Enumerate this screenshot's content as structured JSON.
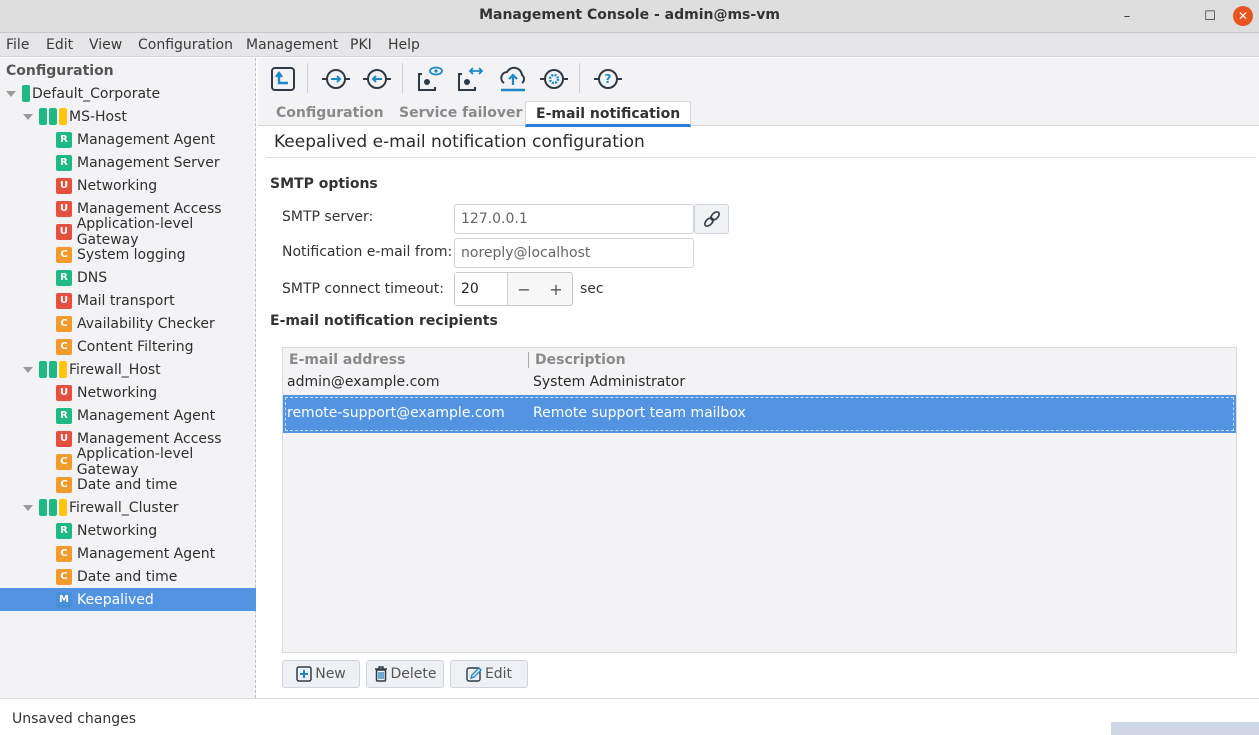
{
  "window": {
    "title": "Management Console - admin@ms-vm",
    "controls": {
      "minimize": "–",
      "maximize": "☐",
      "close": "✕"
    }
  },
  "menubar": [
    "File",
    "Edit",
    "View",
    "Configuration",
    "Management",
    "PKI",
    "Help"
  ],
  "sidebar": {
    "heading": "Configuration",
    "tree": [
      {
        "type": "root",
        "label": "Default_Corporate",
        "bars": [
          "green"
        ]
      },
      {
        "type": "host",
        "label": "MS-Host",
        "bars": [
          "green",
          "green",
          "yellow"
        ]
      },
      {
        "type": "item",
        "badge": "R",
        "label": "Management Agent"
      },
      {
        "type": "item",
        "badge": "R",
        "label": "Management Server"
      },
      {
        "type": "item",
        "badge": "U",
        "label": "Networking"
      },
      {
        "type": "item",
        "badge": "U",
        "label": "Management Access"
      },
      {
        "type": "item",
        "badge": "U",
        "label": "Application-level Gateway"
      },
      {
        "type": "item",
        "badge": "C",
        "label": "System logging"
      },
      {
        "type": "item",
        "badge": "R",
        "label": "DNS"
      },
      {
        "type": "item",
        "badge": "U",
        "label": "Mail transport"
      },
      {
        "type": "item",
        "badge": "C",
        "label": "Availability Checker"
      },
      {
        "type": "item",
        "badge": "C",
        "label": "Content Filtering"
      },
      {
        "type": "host",
        "label": "Firewall_Host",
        "bars": [
          "green",
          "green",
          "yellow"
        ]
      },
      {
        "type": "item",
        "badge": "U",
        "label": "Networking"
      },
      {
        "type": "item",
        "badge": "R",
        "label": "Management Agent"
      },
      {
        "type": "item",
        "badge": "U",
        "label": "Management Access"
      },
      {
        "type": "item",
        "badge": "C",
        "label": "Application-level Gateway"
      },
      {
        "type": "item",
        "badge": "C",
        "label": "Date and time"
      },
      {
        "type": "host",
        "label": "Firewall_Cluster",
        "bars": [
          "green",
          "green",
          "yellow"
        ]
      },
      {
        "type": "item",
        "badge": "R",
        "label": "Networking"
      },
      {
        "type": "item",
        "badge": "C",
        "label": "Management Agent"
      },
      {
        "type": "item",
        "badge": "C",
        "label": "Date and time"
      },
      {
        "type": "item",
        "badge": "M",
        "label": "Keepalived",
        "selected": true
      }
    ]
  },
  "toolbar": {
    "icons": [
      "upload-config-icon",
      "connect-in-icon",
      "connect-out-icon",
      "view-config-icon",
      "compare-config-icon",
      "cloud-upload-icon",
      "settings-icon",
      "help-icon"
    ]
  },
  "tabs": [
    {
      "label": "Configuration",
      "active": false
    },
    {
      "label": "Service failover",
      "active": false
    },
    {
      "label": "E-mail notification",
      "active": true
    }
  ],
  "page": {
    "title": "Keepalived e-mail notification configuration",
    "smtp_section": "SMTP options",
    "smtp_server_label": "SMTP server:",
    "smtp_server_value": "127.0.0.1",
    "from_label": "Notification e-mail from:",
    "from_value": "noreply@localhost",
    "timeout_label": "SMTP connect timeout:",
    "timeout_value": "20",
    "timeout_unit": "sec",
    "minus": "−",
    "plus": "+",
    "recipients_section": "E-mail notification recipients"
  },
  "recipients": {
    "columns": [
      "E-mail address",
      "Description"
    ],
    "rows": [
      {
        "email": "admin@example.com",
        "description": "System Administrator",
        "selected": false
      },
      {
        "email": "remote-support@example.com",
        "description": "Remote support team mailbox",
        "selected": true
      }
    ]
  },
  "actions": {
    "new": "New",
    "delete": "Delete",
    "edit": "Edit"
  },
  "status": {
    "text": "Unsaved changes"
  },
  "colors": {
    "accent": "#5294e2",
    "tab_underline": "#2b7fd8",
    "green": "#1fb985",
    "yellow": "#ffc40c",
    "red": "#e5503f",
    "orange": "#f39a2c",
    "close": "#e95420"
  }
}
